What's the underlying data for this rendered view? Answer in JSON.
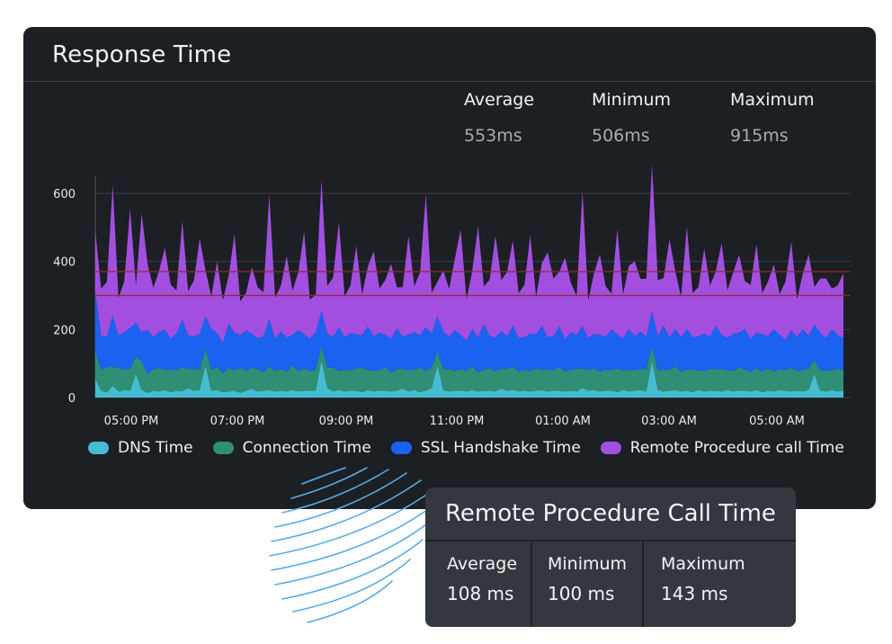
{
  "card": {
    "title": "Response Time",
    "stats": [
      {
        "label": "Average",
        "value": "553ms"
      },
      {
        "label": "Minimum",
        "value": "506ms"
      },
      {
        "label": "Maximum",
        "value": "915ms"
      }
    ]
  },
  "panel": {
    "title": "Remote Procedure Call Time",
    "stats": [
      {
        "label": "Average",
        "value": "108 ms"
      },
      {
        "label": "Minimum",
        "value": "100 ms"
      },
      {
        "label": "Maximum",
        "value": "143 ms"
      }
    ]
  },
  "colors": {
    "dns": "#46bcd0",
    "connection": "#2f8f74",
    "ssl": "#1a62ef",
    "rpc": "#a24fe0",
    "threshold": "#8e2b30",
    "grid": "#3a3f46"
  },
  "chart_data": {
    "type": "area",
    "stacked": true,
    "x_tick_labels": [
      "05:00 PM",
      "07:00 PM",
      "09:00 PM",
      "11:00 PM",
      "01:00 AM",
      "03:00 AM",
      "05:00 AM"
    ],
    "y_ticks": [
      0,
      200,
      400,
      600
    ],
    "ylim": [
      0,
      600
    ],
    "threshold_lines": [
      370,
      300
    ],
    "legend_position": "bottom",
    "grid": true,
    "series": [
      {
        "name": "DNS Time",
        "color_key": "dns",
        "values": [
          55,
          20,
          15,
          35,
          18,
          22,
          20,
          70,
          22,
          14,
          20,
          18,
          22,
          16,
          20,
          18,
          28,
          20,
          22,
          95,
          20,
          22,
          16,
          18,
          20,
          14,
          20,
          26,
          18,
          20,
          22,
          18,
          20,
          18,
          22,
          18,
          20,
          20,
          20,
          110,
          28,
          18,
          22,
          18,
          20,
          20,
          16,
          22,
          18,
          20,
          20,
          18,
          20,
          26,
          18,
          22,
          16,
          20,
          28,
          95,
          22,
          18,
          20,
          20,
          18,
          22,
          18,
          20,
          20,
          18,
          26,
          20,
          22,
          18,
          20,
          18,
          20,
          22,
          18,
          20,
          20,
          18,
          20,
          18,
          28,
          20,
          22,
          18,
          20,
          20,
          16,
          22,
          18,
          20,
          22,
          18,
          110,
          22,
          18,
          20,
          22,
          18,
          20,
          16,
          22,
          18,
          20,
          20,
          18,
          22,
          18,
          20,
          20,
          18,
          22,
          16,
          20,
          18,
          22,
          20,
          18,
          20,
          18,
          22,
          70,
          20,
          18,
          22,
          18,
          20
        ]
      },
      {
        "name": "Connection Time",
        "color_key": "connection",
        "values": [
          80,
          60,
          75,
          55,
          70,
          60,
          65,
          50,
          85,
          55,
          62,
          70,
          58,
          66,
          60,
          72,
          55,
          64,
          60,
          50,
          62,
          68,
          55,
          70,
          60,
          74,
          58,
          62,
          66,
          55,
          70,
          60,
          64,
          58,
          72,
          60,
          66,
          58,
          62,
          40,
          60,
          70,
          55,
          64,
          60,
          66,
          72,
          58,
          62,
          60,
          70,
          55,
          64,
          58,
          62,
          60,
          72,
          58,
          60,
          40,
          62,
          66,
          58,
          64,
          60,
          70,
          56,
          62,
          66,
          58,
          60,
          64,
          70,
          58,
          62,
          60,
          66,
          58,
          64,
          60,
          70,
          58,
          62,
          66,
          58,
          60,
          64,
          58,
          62,
          60,
          70,
          56,
          64,
          60,
          62,
          66,
          40,
          58,
          64,
          60,
          70,
          58,
          62,
          66,
          58,
          60,
          64,
          62,
          66,
          58,
          60,
          70,
          62,
          58,
          64,
          60,
          66,
          58,
          62,
          60,
          70,
          58,
          62,
          64,
          40,
          60,
          62,
          58,
          66,
          60
        ]
      },
      {
        "name": "SSL Handshake Time",
        "color_key": "ssl",
        "values": [
          180,
          100,
          90,
          150,
          95,
          110,
          120,
          100,
          85,
          130,
          95,
          105,
          120,
          90,
          110,
          140,
          100,
          95,
          105,
          95,
          120,
          100,
          90,
          130,
          110,
          95,
          120,
          100,
          90,
          105,
          140,
          95,
          110,
          100,
          90,
          120,
          100,
          95,
          110,
          105,
          100,
          90,
          130,
          95,
          110,
          100,
          95,
          130,
          100,
          110,
          95,
          100,
          120,
          95,
          105,
          110,
          95,
          130,
          100,
          105,
          110,
          95,
          120,
          100,
          90,
          110,
          100,
          135,
          95,
          100,
          110,
          95,
          120,
          100,
          95,
          110,
          100,
          130,
          95,
          100,
          120,
          95,
          110,
          100,
          125,
          95,
          100,
          110,
          95,
          120,
          100,
          95,
          120,
          100,
          110,
          95,
          105,
          100,
          130,
          95,
          110,
          100,
          120,
          95,
          100,
          110,
          95,
          130,
          100,
          95,
          110,
          100,
          120,
          95,
          105,
          110,
          95,
          125,
          100,
          90,
          110,
          100,
          120,
          95,
          105,
          110,
          95,
          120,
          100,
          95
        ]
      },
      {
        "name": "Remote Procedure call Time",
        "color_key": "rpc",
        "values": [
          175,
          140,
          160,
          385,
          110,
          150,
          350,
          110,
          350,
          195,
          145,
          180,
          240,
          160,
          125,
          290,
          130,
          165,
          280,
          135,
          95,
          210,
          125,
          140,
          290,
          100,
          110,
          195,
          150,
          130,
          365,
          120,
          135,
          240,
          130,
          170,
          300,
          115,
          110,
          385,
          140,
          175,
          310,
          120,
          140,
          260,
          120,
          175,
          250,
          130,
          160,
          220,
          120,
          145,
          290,
          135,
          185,
          390,
          120,
          100,
          180,
          140,
          210,
          310,
          120,
          170,
          330,
          110,
          165,
          300,
          150,
          190,
          250,
          130,
          155,
          290,
          110,
          185,
          250,
          170,
          160,
          240,
          145,
          115,
          395,
          110,
          180,
          235,
          150,
          105,
          310,
          130,
          185,
          220,
          155,
          170,
          430,
          165,
          140,
          290,
          170,
          120,
          300,
          130,
          145,
          250,
          150,
          160,
          270,
          140,
          180,
          230,
          140,
          160,
          260,
          120,
          160,
          190,
          120,
          170,
          260,
          110,
          165,
          240,
          110,
          160,
          175,
          120,
          145,
          190
        ]
      }
    ]
  }
}
